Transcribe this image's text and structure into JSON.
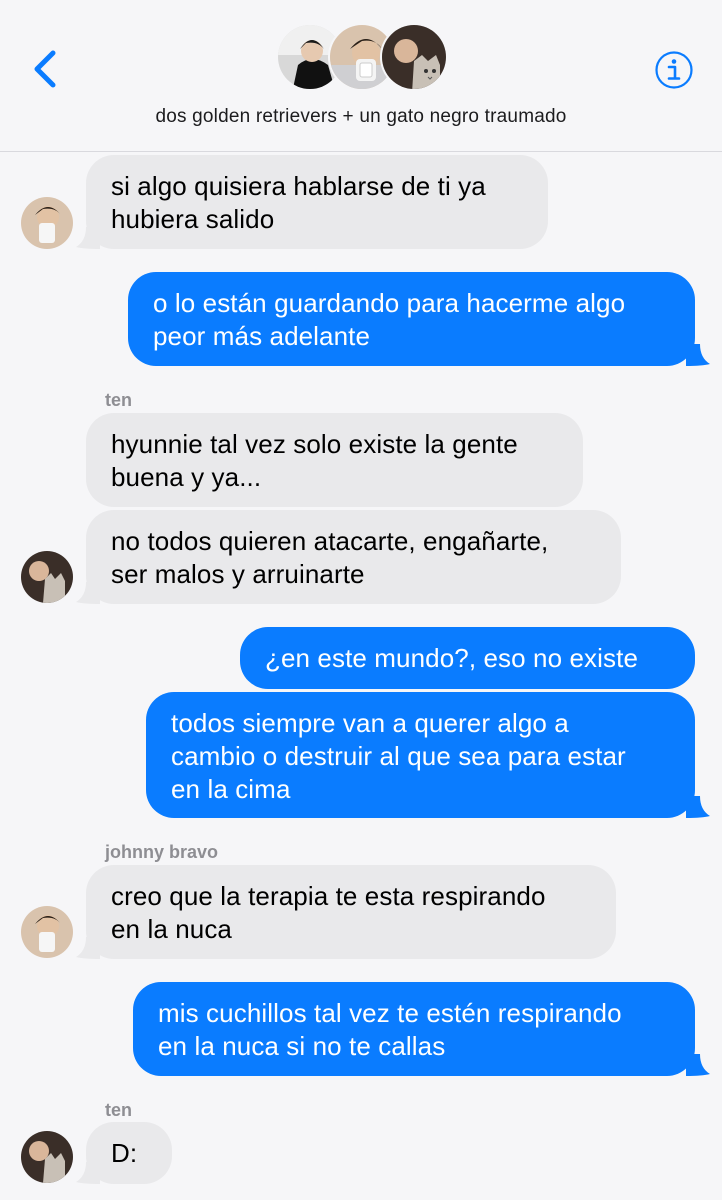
{
  "header": {
    "group_name": "dos golden retrievers + un gato negro traumado",
    "back_icon": "chevron-left-icon",
    "info_icon": "info-circle-icon",
    "accent_color": "#0a7cff"
  },
  "messages": [
    {
      "direction": "incoming",
      "text_lines": [
        "si algo quisiera hablarse de ti ya",
        "hubiera salido"
      ]
    },
    {
      "direction": "outgoing",
      "text_lines": [
        "o lo están guardando para hacerme algo",
        "peor más adelante"
      ]
    },
    {
      "direction": "incoming",
      "sender": "ten",
      "text_lines": [
        "hyunnie tal vez solo existe la gente",
        "buena y ya..."
      ]
    },
    {
      "direction": "incoming",
      "text_lines": [
        "no todos quieren atacarte, engañarte,",
        "ser malos y arruinarte"
      ]
    },
    {
      "direction": "outgoing",
      "text_lines": [
        "¿en este mundo?, eso no existe"
      ]
    },
    {
      "direction": "outgoing",
      "text_lines": [
        "todos siempre van a querer algo a",
        "cambio o destruir al que sea para estar",
        "en la cima"
      ]
    },
    {
      "direction": "incoming",
      "sender": "johnny bravo",
      "text_lines": [
        "creo que la terapia te esta respirando",
        "en la nuca"
      ]
    },
    {
      "direction": "outgoing",
      "text_lines": [
        "mis cuchillos tal vez te estén respirando",
        "en la nuca si no te callas"
      ]
    },
    {
      "direction": "incoming",
      "sender": "ten",
      "text_lines": [
        "D:"
      ]
    }
  ],
  "colors": {
    "incoming_bubble": "#e9e9eb",
    "outgoing_bubble": "#0a7cff",
    "sender_label": "#8e8e93"
  }
}
